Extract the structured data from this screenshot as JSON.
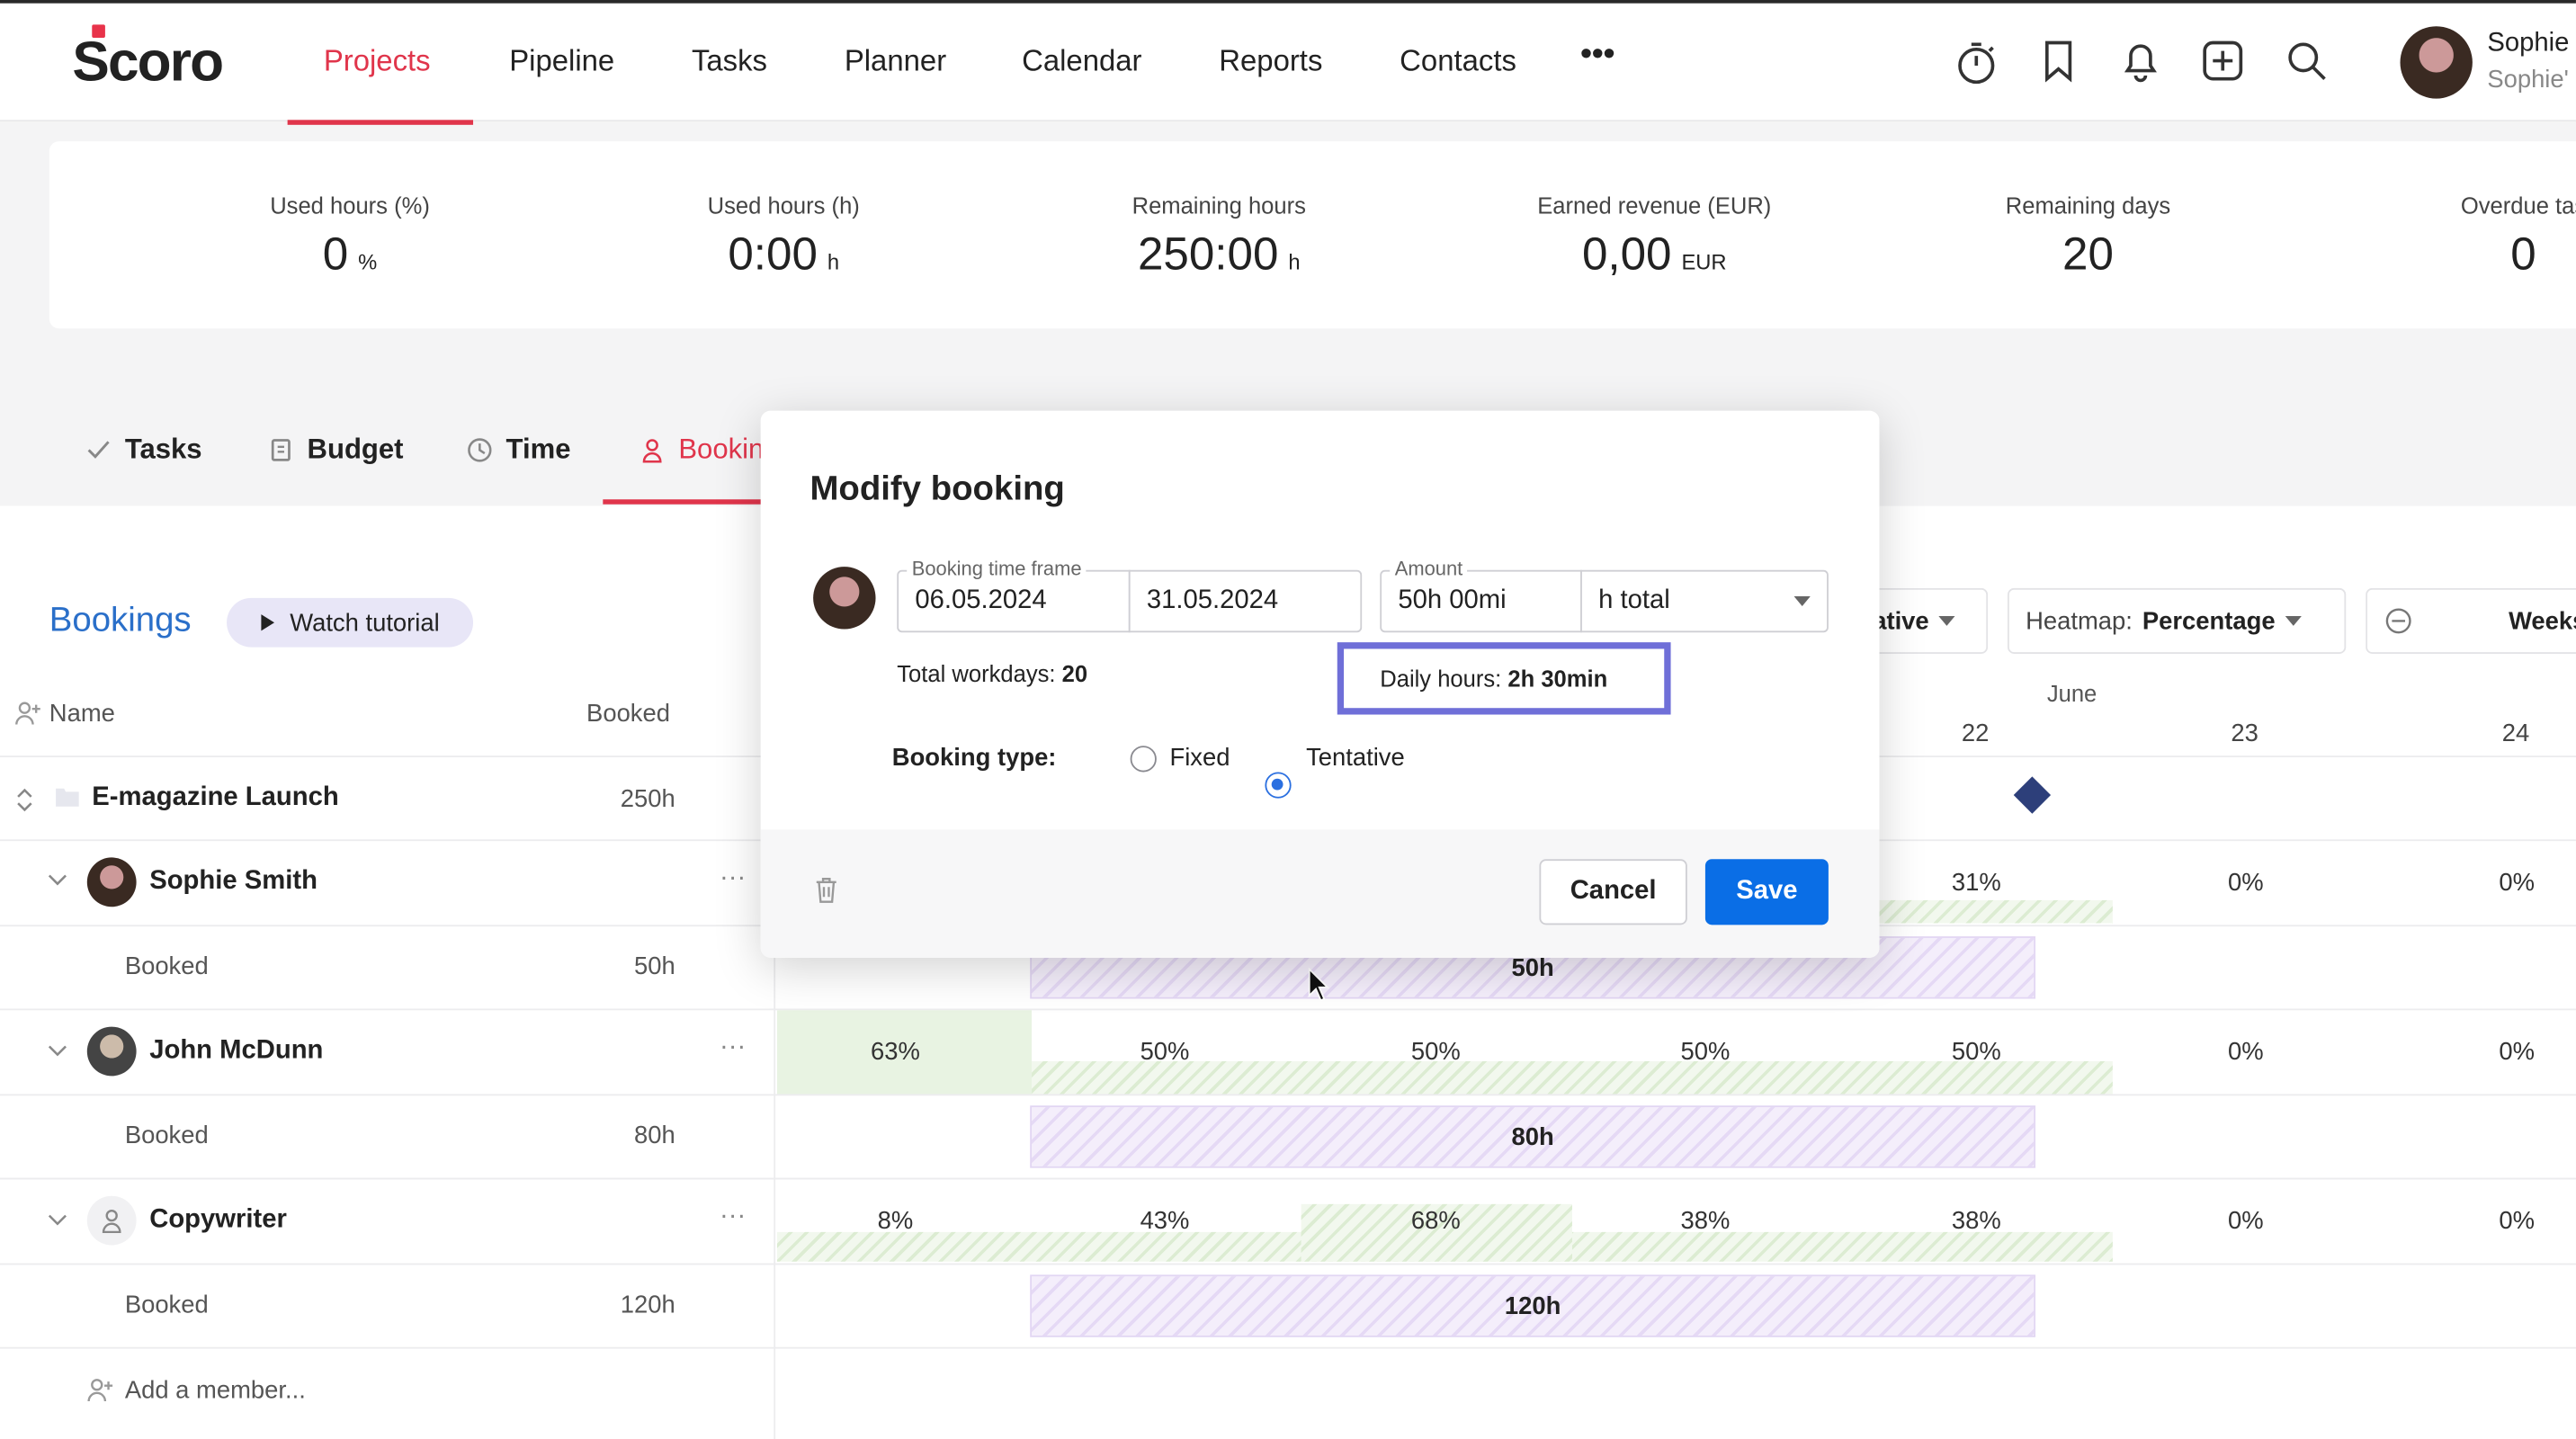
{
  "nav": {
    "logo": "Scoro",
    "items": [
      "Projects",
      "Pipeline",
      "Tasks",
      "Planner",
      "Calendar",
      "Reports",
      "Contacts"
    ],
    "more": "•••",
    "user_name": "Sophie",
    "user_sub": "Sophie'"
  },
  "stats": [
    {
      "label": "Used hours (%)",
      "value": "0",
      "unit": "%"
    },
    {
      "label": "Used hours (h)",
      "value": "0:00",
      "unit": "h"
    },
    {
      "label": "Remaining hours",
      "value": "250:00",
      "unit": "h"
    },
    {
      "label": "Earned revenue (EUR)",
      "value": "0,00",
      "unit": "EUR"
    },
    {
      "label": "Remaining days",
      "value": "20",
      "unit": ""
    },
    {
      "label": "Overdue tas",
      "value": "0",
      "unit": ""
    }
  ],
  "tabs": [
    "Tasks",
    "Budget",
    "Time",
    "Bookin"
  ],
  "bookings": {
    "title": "Bookings",
    "tutorial": "Watch tutorial",
    "col_name": "Name",
    "col_booked": "Booked",
    "project": {
      "name": "E-magazine Launch",
      "booked": "250h"
    },
    "members": [
      {
        "name": "Sophie Smith",
        "sub": "Booked",
        "booked": "50h",
        "bar": "50h",
        "pcts": [
          "31%",
          "0%",
          "0%"
        ]
      },
      {
        "name": "John McDunn",
        "sub": "Booked",
        "booked": "80h",
        "bar": "80h",
        "pcts": [
          "63%",
          "50%",
          "50%",
          "50%",
          "50%",
          "0%",
          "0%"
        ]
      },
      {
        "name": "Copywriter",
        "sub": "Booked",
        "booked": "120h",
        "bar": "120h",
        "pcts": [
          "8%",
          "43%",
          "68%",
          "38%",
          "38%",
          "0%",
          "0%"
        ]
      }
    ],
    "add_member": "Add a member..."
  },
  "controls": {
    "tentative": "ative",
    "heatmap_label": "Heatmap:",
    "heatmap_value": "Percentage",
    "weeks": "Weeks",
    "month": "June",
    "days": [
      "22",
      "23",
      "24"
    ]
  },
  "modal": {
    "title": "Modify booking",
    "timeframe_label": "Booking time frame",
    "date_from": "06.05.2024",
    "date_to": "31.05.2024",
    "amount_label": "Amount",
    "amount_value": "50h 00mi",
    "amount_unit": "h total",
    "workdays_label": "Total workdays:",
    "workdays_value": "20",
    "daily_label": "Daily hours:",
    "daily_value": "2h 30min",
    "type_label": "Booking type:",
    "type_fixed": "Fixed",
    "type_tentative": "Tentative",
    "selected_type": "Tentative",
    "cancel": "Cancel",
    "save": "Save"
  },
  "colors": {
    "accent": "#e0354b",
    "primary": "#0a6ee6",
    "link": "#2a6fc9",
    "highlight_border": "#6f6fd8"
  }
}
